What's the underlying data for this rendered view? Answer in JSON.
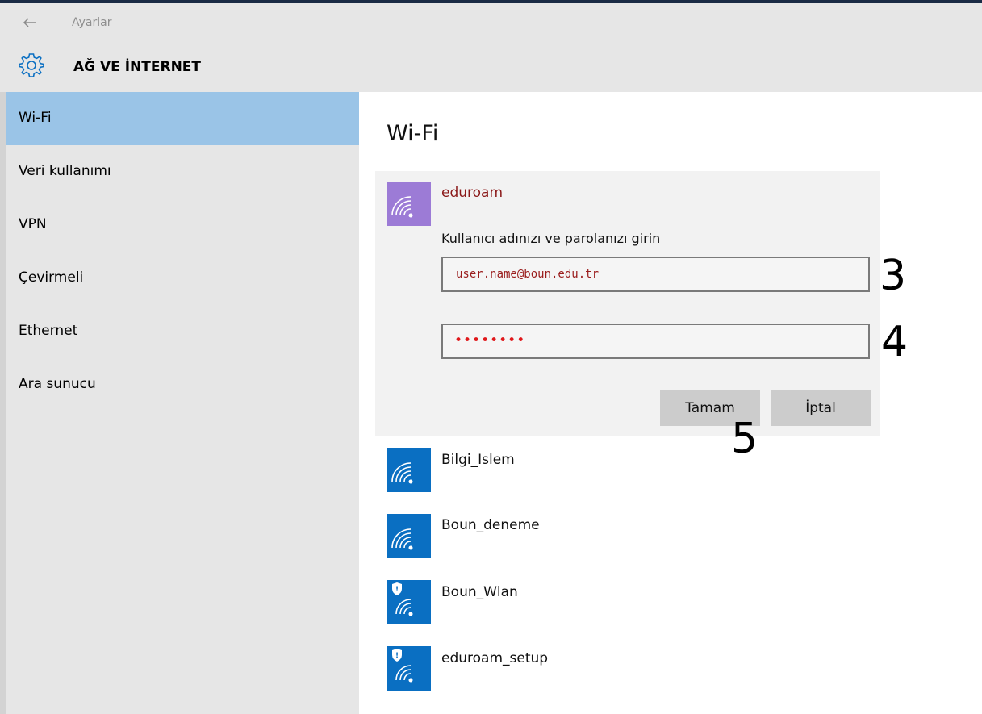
{
  "window": {
    "app_title": "Ayarlar",
    "section_title": "AĞ VE İNTERNET"
  },
  "sidebar": {
    "items": [
      {
        "label": "Wi-Fi",
        "selected": true
      },
      {
        "label": "Veri kullanımı"
      },
      {
        "label": "VPN"
      },
      {
        "label": "Çevirmeli"
      },
      {
        "label": "Ethernet"
      },
      {
        "label": "Ara sunucu"
      }
    ]
  },
  "main": {
    "page_title": "Wi-Fi",
    "selected_network": {
      "name": "eduroam",
      "prompt": "Kullanıcı adınızı ve parolanızı girin",
      "username_value": "user.name@boun.edu.tr",
      "password_mask": "••••••••",
      "ok_label": "Tamam",
      "cancel_label": "İptal"
    },
    "networks": [
      {
        "name": "Bilgi_Islem",
        "secured": false
      },
      {
        "name": "Boun_deneme",
        "secured": false
      },
      {
        "name": "Boun_Wlan",
        "secured": true
      },
      {
        "name": "eduroam_setup",
        "secured": true
      }
    ]
  },
  "annotations": {
    "step_username": "3",
    "step_password": "4",
    "step_ok": "5"
  },
  "colors": {
    "accent_blue": "#0a6fc2",
    "selected_network_tile": "#9c7bd6",
    "sidebar_selected": "#9ac4e7"
  }
}
